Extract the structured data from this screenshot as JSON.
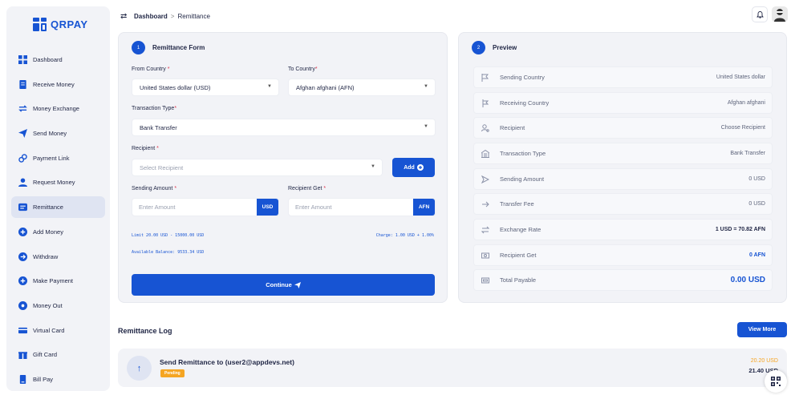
{
  "brand": {
    "name": "QRPAY"
  },
  "colors": {
    "accent": "#1754d3",
    "pending": "#f5a523"
  },
  "breadcrumb": {
    "parent": "Dashboard",
    "separator": ">",
    "current": "Remittance"
  },
  "sidebar": {
    "items": [
      {
        "label": "Dashboard",
        "icon": "grid-icon"
      },
      {
        "label": "Receive Money",
        "icon": "receipt-icon"
      },
      {
        "label": "Money Exchange",
        "icon": "exchange-icon"
      },
      {
        "label": "Send Money",
        "icon": "send-icon"
      },
      {
        "label": "Payment Link",
        "icon": "link-icon"
      },
      {
        "label": "Request Money",
        "icon": "user-request-icon"
      },
      {
        "label": "Remittance",
        "icon": "remittance-icon"
      },
      {
        "label": "Add Money",
        "icon": "plus-circle-icon"
      },
      {
        "label": "Withdraw",
        "icon": "arrow-circle-icon"
      },
      {
        "label": "Make Payment",
        "icon": "plus-circle-icon"
      },
      {
        "label": "Money Out",
        "icon": "minus-circle-icon"
      },
      {
        "label": "Virtual Card",
        "icon": "card-icon"
      },
      {
        "label": "Gift Card",
        "icon": "gift-icon"
      },
      {
        "label": "Bill Pay",
        "icon": "bill-icon"
      }
    ],
    "active_index": 6
  },
  "form": {
    "badge": "1",
    "title": "Remittance Form",
    "from_country_label": "From Country",
    "from_country_value": "United States dollar (USD)",
    "to_country_label": "To Country",
    "to_country_value": "Afghan afghani (AFN)",
    "transaction_type_label": "Transaction Type",
    "transaction_type_value": "Bank Transfer",
    "recipient_label": "Recipient",
    "recipient_placeholder": "Select Recipient",
    "add_button": "Add",
    "sending_amount_label": "Sending Amount",
    "sending_amount_placeholder": "Enter Amount",
    "sending_currency": "USD",
    "recipient_get_label": "Recipient Get",
    "recipient_get_placeholder": "Enter Amount",
    "recipient_currency": "AFN",
    "limit_text": "Limit 20.00 USD - 15000.00 USD",
    "charge_text": "Charge: 1.00 USD + 1.00%",
    "balance_text": "Available Balance: 9533.34 USD",
    "continue_button": "Continue",
    "required_mark": "*"
  },
  "preview": {
    "badge": "2",
    "title": "Preview",
    "rows": [
      {
        "label": "Sending Country",
        "value": "United States dollar",
        "icon": "flag-icon"
      },
      {
        "label": "Receiving Country",
        "value": "Afghan afghani",
        "icon": "flag-return-icon"
      },
      {
        "label": "Recipient",
        "value": "Choose Recipient",
        "icon": "user-search-icon"
      },
      {
        "label": "Transaction Type",
        "value": "Bank Transfer",
        "icon": "bank-icon"
      },
      {
        "label": "Sending Amount",
        "value": "0 USD",
        "icon": "send-outline-icon"
      },
      {
        "label": "Transfer Fee",
        "value": "0 USD",
        "icon": "arrow-right-icon"
      },
      {
        "label": "Exchange Rate",
        "value": "1 USD = 70.82 AFN",
        "icon": "exchange-icon"
      },
      {
        "label": "Recipient Get",
        "value": "0 AFN",
        "icon": "cash-icon"
      },
      {
        "label": "Total Payable",
        "value": "0.00 USD",
        "icon": "cash-stack-icon"
      }
    ]
  },
  "log": {
    "title": "Remittance Log",
    "view_more": "View More",
    "items": [
      {
        "title": "Send Remittance to (user2@appdevs.net)",
        "status": "Pending",
        "amount_primary": "20.20 USD",
        "amount_secondary": "21.40 USD"
      }
    ]
  }
}
